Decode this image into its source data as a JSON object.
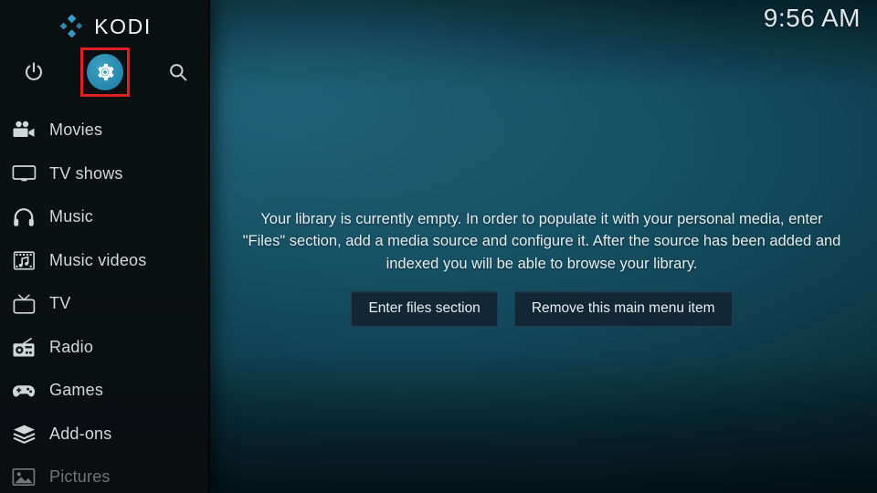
{
  "app": {
    "name": "KODI",
    "logo_icon": "kodi-logo-icon"
  },
  "clock": {
    "time": "9:56 AM"
  },
  "top_icons": [
    {
      "name": "power-icon",
      "label": "Power"
    },
    {
      "name": "settings-gear-icon",
      "label": "Settings"
    },
    {
      "name": "search-icon",
      "label": "Search"
    }
  ],
  "sidebar": {
    "items": [
      {
        "label": "Movies",
        "icon": "movie-camera-icon",
        "dim": false
      },
      {
        "label": "TV shows",
        "icon": "monitor-icon",
        "dim": false
      },
      {
        "label": "Music",
        "icon": "headphones-icon",
        "dim": false
      },
      {
        "label": "Music videos",
        "icon": "film-music-icon",
        "dim": false
      },
      {
        "label": "TV",
        "icon": "television-icon",
        "dim": false
      },
      {
        "label": "Radio",
        "icon": "radio-icon",
        "dim": false
      },
      {
        "label": "Games",
        "icon": "gamepad-icon",
        "dim": false
      },
      {
        "label": "Add-ons",
        "icon": "addons-box-icon",
        "dim": false
      },
      {
        "label": "Pictures",
        "icon": "picture-icon",
        "dim": true
      }
    ]
  },
  "main": {
    "empty_message": "Your library is currently empty. In order to populate it with your personal media, enter \"Files\" section, add a media source and configure it. After the source has been added and indexed you will be able to browse your library.",
    "buttons": [
      {
        "label": "Enter files section"
      },
      {
        "label": "Remove this main menu item"
      }
    ]
  },
  "colors": {
    "highlight_box": "#e02020",
    "settings_disc": "#2e8fb5",
    "logo_blue": "#3ba5d8",
    "sidebar_bg": "#0a0f11",
    "button_bg": "#122734",
    "text_primary": "#e4ecef",
    "text_dim": "#6f7578"
  }
}
